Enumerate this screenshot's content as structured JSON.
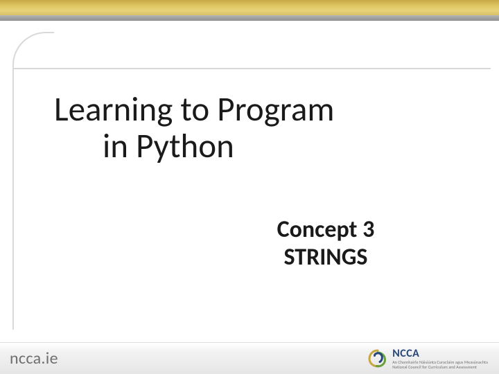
{
  "title": {
    "line1": "Learning to Program",
    "line2": "in Python"
  },
  "subtitle": {
    "line1": "Concept  3",
    "line2": "STRINGS"
  },
  "footer": {
    "site": "ncca.ie",
    "org_abbr": "NCCA",
    "org_full_line1": "An Chomhairle Náisiúnta Curaclaim agus Measúnachta",
    "org_full_line2": "National Council for Curriculum and Assessment"
  },
  "colors": {
    "accent_yellow": "#d9c068",
    "logo_blue": "#29487a",
    "logo_green": "#6aa03b",
    "logo_gold": "#caa63f"
  }
}
